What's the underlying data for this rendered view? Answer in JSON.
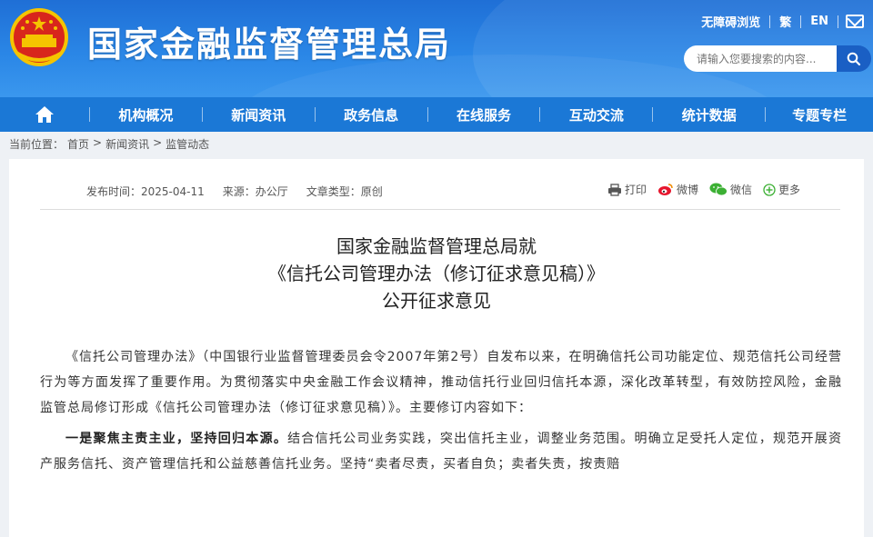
{
  "header": {
    "site_title": "国家金融监督管理总局",
    "links": [
      "无障碍浏览",
      "繁",
      "EN"
    ],
    "search_placeholder": "请输入您要搜索的内容..."
  },
  "nav": {
    "items": [
      "机构概况",
      "新闻资讯",
      "政务信息",
      "在线服务",
      "互动交流",
      "统计数据",
      "专题专栏"
    ]
  },
  "breadcrumb": {
    "prefix": "当前位置：",
    "crumbs": [
      "首页",
      "新闻资讯",
      "监管动态"
    ],
    "sep": ">"
  },
  "article": {
    "meta": {
      "date": "发布时间：2025-04-11",
      "source": "来源：办公厅",
      "type": "文章类型：原创"
    },
    "share": {
      "print": "打印",
      "weibo": "微博",
      "wechat": "微信",
      "more": "更多"
    },
    "title_lines": [
      "国家金融监督管理总局就",
      "《信托公司管理办法（修订征求意见稿）》",
      "公开征求意见"
    ],
    "para1": "《信托公司管理办法》（中国银行业监督管理委员会令2007年第2号）自发布以来，在明确信托公司功能定位、规范信托公司经营行为等方面发挥了重要作用。为贯彻落实中央金融工作会议精神，推动信托行业回归信托本源，深化改革转型，有效防控风险，金融监管总局修订形成《信托公司管理办法（修订征求意见稿）》。主要修订内容如下：",
    "para2_bold": "一是聚焦主责主业，坚持回归本源。",
    "para2": "结合信托公司业务实践，突出信托主业，调整业务范围。明确立足受托人定位，规范开展资产服务信托、资产管理信托和公益慈善信托业务。坚持“卖者尽责，买者自负；卖者失责，按责赔"
  },
  "colors": {
    "header_blue": "#2a86e6",
    "nav_blue": "#1b78d6"
  }
}
